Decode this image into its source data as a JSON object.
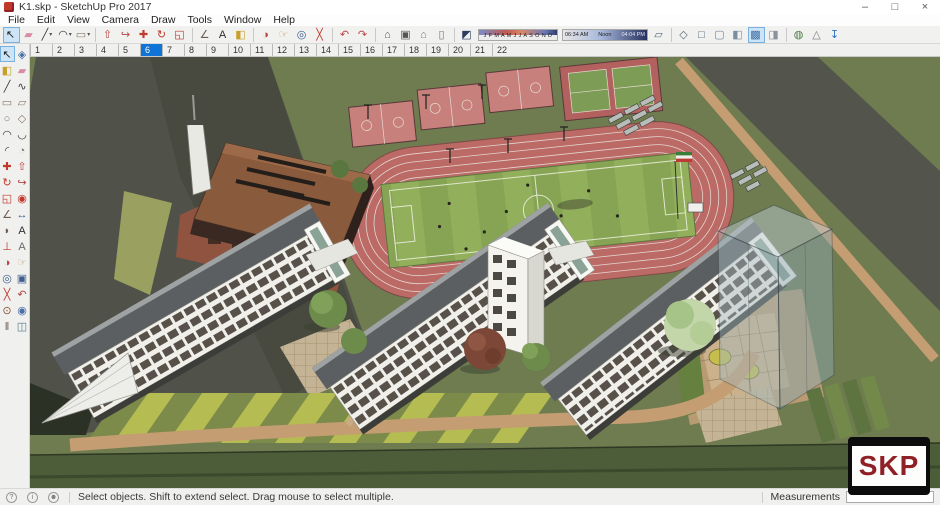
{
  "window": {
    "title": "K1.skp - SketchUp Pro 2017",
    "controls": [
      {
        "name": "minimize-button",
        "glyph": "–"
      },
      {
        "name": "maximize-button",
        "glyph": "□"
      },
      {
        "name": "close-button",
        "glyph": "×"
      }
    ]
  },
  "menu": {
    "items": [
      {
        "label": "File",
        "name": "menu-file"
      },
      {
        "label": "Edit",
        "name": "menu-edit"
      },
      {
        "label": "View",
        "name": "menu-view"
      },
      {
        "label": "Camera",
        "name": "menu-camera"
      },
      {
        "label": "Draw",
        "name": "menu-draw"
      },
      {
        "label": "Tools",
        "name": "menu-tools"
      },
      {
        "label": "Window",
        "name": "menu-window"
      },
      {
        "label": "Help",
        "name": "menu-help"
      }
    ]
  },
  "toolbar": {
    "items_left": [
      {
        "name": "select-tool",
        "glyph": "↖",
        "color": "#1a1a1a",
        "cls": "pressed"
      },
      {
        "name": "eraser-tool",
        "glyph": "▰",
        "color": "#d98ca5"
      },
      {
        "name": "line-tool",
        "glyph": "╱",
        "color": "#3c3c3c",
        "dd": "▾"
      },
      {
        "name": "arcs-tool",
        "glyph": "◠",
        "color": "#3c3c3c",
        "dd": "▾"
      },
      {
        "name": "shapes-tool",
        "glyph": "▭",
        "color": "#8a7a68",
        "dd": "▾"
      },
      {
        "cls": "sep"
      },
      {
        "name": "push-pull-tool",
        "glyph": "⇧",
        "color": "#b5443f"
      },
      {
        "name": "follow-me-tool",
        "glyph": "↪",
        "color": "#b5443f"
      },
      {
        "name": "move-tool",
        "glyph": "✚",
        "color": "#c0392b"
      },
      {
        "name": "rotate-tool",
        "glyph": "↻",
        "color": "#c0392b"
      },
      {
        "name": "scale-tool",
        "glyph": "◱",
        "color": "#c0392b"
      },
      {
        "cls": "sep"
      },
      {
        "name": "tape-measure-tool",
        "glyph": "∠",
        "color": "#6b5d4f"
      },
      {
        "name": "text-tool",
        "glyph": "A",
        "color": "#2f2f2f"
      },
      {
        "name": "paint-bucket-tool",
        "glyph": "◧",
        "color": "#c8a028"
      },
      {
        "cls": "sep"
      },
      {
        "name": "orbit-tool",
        "glyph": "◑",
        "color": "#b5443f"
      },
      {
        "name": "pan-tool",
        "glyph": "☞",
        "color": "#c9a06a"
      },
      {
        "name": "zoom-tool",
        "glyph": "◎",
        "color": "#3f5e8c"
      },
      {
        "name": "zoom-extents-tool",
        "glyph": "╳",
        "color": "#c0392b"
      },
      {
        "cls": "sep"
      },
      {
        "name": "previous-view-button",
        "glyph": "↶",
        "color": "#b5443f"
      },
      {
        "name": "next-view-button",
        "glyph": "↷",
        "color": "#b5443f"
      },
      {
        "cls": "sep"
      },
      {
        "name": "view-iso-button",
        "glyph": "⌂",
        "color": "#555555"
      },
      {
        "name": "view-top-button",
        "glyph": "▣",
        "color": "#555555"
      },
      {
        "name": "view-front-button",
        "glyph": "⌂",
        "color": "#777777"
      },
      {
        "name": "view-right-button",
        "glyph": "▯",
        "color": "#777777"
      },
      {
        "cls": "sep"
      },
      {
        "name": "shadows-toggle",
        "glyph": "◩",
        "color": "#2e3d5e"
      }
    ],
    "shadows": {
      "months": "J F M A M J J A S O N D",
      "time_start": "06:34 AM",
      "time_mid": "Noon",
      "time_end": "04:04 PM"
    },
    "items_right": [
      {
        "name": "xray-style-button",
        "glyph": "▱",
        "color": "#5a6b7c"
      },
      {
        "cls": "sep"
      },
      {
        "name": "back-edges-style-button",
        "glyph": "◇",
        "color": "#556677"
      },
      {
        "name": "wireframe-style-button",
        "glyph": "□",
        "color": "#556677"
      },
      {
        "name": "hidden-line-style-button",
        "glyph": "▢",
        "color": "#778899"
      },
      {
        "name": "shaded-style-button",
        "glyph": "◧",
        "color": "#7b8ea0"
      },
      {
        "name": "shaded-with-textures-style-button",
        "glyph": "▩",
        "color": "#3f6fa0",
        "cls": "pressed"
      },
      {
        "name": "monochrome-style-button",
        "glyph": "◨",
        "color": "#8a919a"
      },
      {
        "cls": "sep"
      },
      {
        "name": "add-location-button",
        "glyph": "◍",
        "color": "#4a7c3f"
      },
      {
        "name": "toggle-terrain-button",
        "glyph": "△",
        "color": "#7d7d7d"
      },
      {
        "name": "photo-textures-button",
        "glyph": "↧",
        "color": "#2d6fc2"
      }
    ]
  },
  "scene_tabs": {
    "active": "6",
    "tabs": [
      {
        "label": "1",
        "name": "scene-tab-1"
      },
      {
        "label": "2",
        "name": "scene-tab-2"
      },
      {
        "label": "3",
        "name": "scene-tab-3"
      },
      {
        "label": "4",
        "name": "scene-tab-4"
      },
      {
        "label": "5",
        "name": "scene-tab-5"
      },
      {
        "label": "6",
        "name": "scene-tab-6",
        "cls": "active"
      },
      {
        "label": "7",
        "name": "scene-tab-7"
      },
      {
        "label": "8",
        "name": "scene-tab-8"
      },
      {
        "label": "9",
        "name": "scene-tab-9"
      },
      {
        "label": "10",
        "name": "scene-tab-10"
      },
      {
        "label": "11",
        "name": "scene-tab-11"
      },
      {
        "label": "12",
        "name": "scene-tab-12"
      },
      {
        "label": "13",
        "name": "scene-tab-13"
      },
      {
        "label": "14",
        "name": "scene-tab-14"
      },
      {
        "label": "15",
        "name": "scene-tab-15"
      },
      {
        "label": "16",
        "name": "scene-tab-16"
      },
      {
        "label": "17",
        "name": "scene-tab-17"
      },
      {
        "label": "18",
        "name": "scene-tab-18"
      },
      {
        "label": "19",
        "name": "scene-tab-19"
      },
      {
        "label": "20",
        "name": "scene-tab-20"
      },
      {
        "label": "21",
        "name": "scene-tab-21"
      },
      {
        "label": "22",
        "name": "scene-tab-22"
      }
    ]
  },
  "left_toolbar": {
    "items": [
      {
        "name": "select-tool",
        "glyph": "↖",
        "color": "#1a1a1a",
        "cls": "pressed"
      },
      {
        "name": "make-component-tool",
        "glyph": "◈",
        "color": "#4a6fa5"
      },
      {
        "name": "paint-bucket-tool",
        "glyph": "◧",
        "color": "#c8a028"
      },
      {
        "name": "eraser-tool",
        "glyph": "▰",
        "color": "#d98ca5"
      },
      {
        "name": "line-tool",
        "glyph": "╱",
        "color": "#3c3c3c"
      },
      {
        "name": "freehand-tool",
        "glyph": "∿",
        "color": "#3c3c3c"
      },
      {
        "name": "rectangle-tool",
        "glyph": "▭",
        "color": "#8a7a68"
      },
      {
        "name": "rotated-rectangle-tool",
        "glyph": "▱",
        "color": "#8a7a68"
      },
      {
        "name": "circle-tool",
        "glyph": "○",
        "color": "#8a7a68"
      },
      {
        "name": "polygon-tool",
        "glyph": "◇",
        "color": "#8a7a68"
      },
      {
        "name": "arc-tool",
        "glyph": "◠",
        "color": "#3c3c3c"
      },
      {
        "name": "two-point-arc-tool",
        "glyph": "◡",
        "color": "#3c3c3c"
      },
      {
        "name": "three-point-arc-tool",
        "glyph": "◜",
        "color": "#3c3c3c"
      },
      {
        "name": "pie-tool",
        "glyph": "◔",
        "color": "#8a7a68"
      },
      {
        "name": "move-tool",
        "glyph": "✚",
        "color": "#c0392b"
      },
      {
        "name": "push-pull-tool",
        "glyph": "⇧",
        "color": "#b5443f"
      },
      {
        "name": "rotate-tool",
        "glyph": "↻",
        "color": "#c0392b"
      },
      {
        "name": "follow-me-tool",
        "glyph": "↪",
        "color": "#b5443f"
      },
      {
        "name": "scale-tool",
        "glyph": "◱",
        "color": "#c0392b"
      },
      {
        "name": "offset-tool",
        "glyph": "◉",
        "color": "#c0392b"
      },
      {
        "name": "tape-measure-tool",
        "glyph": "∠",
        "color": "#6b5d4f"
      },
      {
        "name": "dimension-tool",
        "glyph": "↔",
        "color": "#3f5e8c"
      },
      {
        "name": "protractor-tool",
        "glyph": "◗",
        "color": "#6b5d4f"
      },
      {
        "name": "text-tool",
        "glyph": "A",
        "color": "#2f2f2f"
      },
      {
        "name": "axes-tool",
        "glyph": "⊥",
        "color": "#c0392b"
      },
      {
        "name": "3d-text-tool",
        "glyph": "A",
        "color": "#6b6b6b"
      },
      {
        "name": "orbit-tool",
        "glyph": "◑",
        "color": "#b5443f"
      },
      {
        "name": "pan-tool",
        "glyph": "☞",
        "color": "#c9a06a"
      },
      {
        "name": "zoom-tool",
        "glyph": "◎",
        "color": "#3f5e8c"
      },
      {
        "name": "zoom-window-tool",
        "glyph": "▣",
        "color": "#3f5e8c"
      },
      {
        "name": "zoom-extents-tool",
        "glyph": "╳",
        "color": "#c0392b"
      },
      {
        "name": "previous-view-button",
        "glyph": "↶",
        "color": "#b5443f"
      },
      {
        "name": "position-camera-tool",
        "glyph": "⊙",
        "color": "#8a5a3a"
      },
      {
        "name": "look-around-tool",
        "glyph": "◉",
        "color": "#4a6fa5"
      },
      {
        "name": "walk-tool",
        "glyph": "‖",
        "color": "#6b5d4f"
      },
      {
        "name": "section-plane-tool",
        "glyph": "◫",
        "color": "#5a7d8c"
      }
    ]
  },
  "statusbar": {
    "icons": [
      {
        "glyph": "?",
        "name": "geolocation-icon"
      },
      {
        "glyph": "i",
        "name": "credits-icon"
      },
      {
        "glyph": "☻",
        "name": "user-icon"
      }
    ],
    "hint": "Select objects. Shift to extend select. Drag mouse to select multiple.",
    "measurements_label": "Measurements",
    "measurements_value": ""
  },
  "watermark": {
    "text": "SKP"
  },
  "colors": {
    "titlebar_bg": "#ffffff",
    "toolbar_bg": "#f1f1f0",
    "active_tab": "#1073d6",
    "selected_tool_bg": "#cde4f7",
    "viewport_ground": "#6e7c50",
    "road": "#53554d",
    "running_track": "#bc6a66",
    "basketball_court": "#c8807c",
    "tennis_green": "#7d9c55",
    "field_green": "#8aa854",
    "building_white": "#f0efe9",
    "roof_gray": "#5c5f61",
    "gym_brown": "#8a5a3d",
    "lawn_yellow": "#b5bc52",
    "lawn_olive": "#7c8b4a",
    "path_tan": "#c49d72",
    "glass_blue": "#8fa7ae",
    "watermark_red": "#8f2025"
  }
}
